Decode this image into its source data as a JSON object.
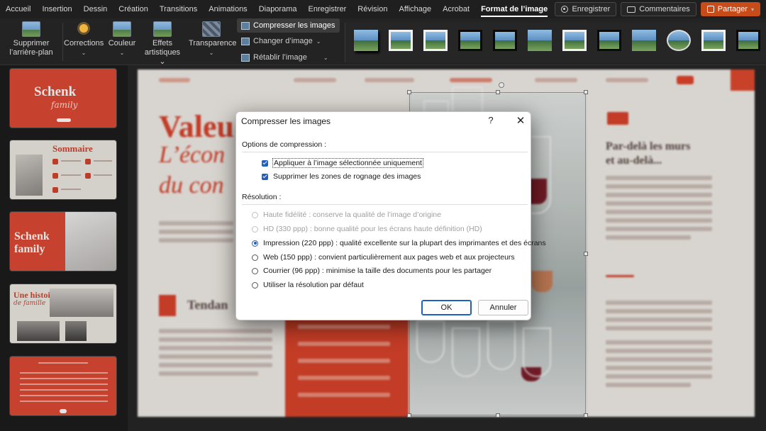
{
  "menu": {
    "tabs": [
      "Accueil",
      "Insertion",
      "Dessin",
      "Création",
      "Transitions",
      "Animations",
      "Diaporama",
      "Enregistrer",
      "Révision",
      "Affichage",
      "Acrobat",
      "Format de l’image"
    ],
    "active_tab": "Format de l’image",
    "record_label": "Enregistrer",
    "comments_label": "Commentaires",
    "share_label": "Partager"
  },
  "ribbon": {
    "remove_bg_l1": "Supprimer",
    "remove_bg_l2": "l’arrière-plan",
    "corrections_label": "Corrections",
    "color_label": "Couleur",
    "effects_l1": "Effets",
    "effects_l2": "artistiques",
    "transparency_label": "Transparence",
    "compress_label": "Compresser les images",
    "change_label": "Changer d’image",
    "reset_label": "Rétablir l’image"
  },
  "thumbnails": {
    "s1_title": "Schenk",
    "s1_sub": "family",
    "s2_title": "Sommaire",
    "s3_title_1": "Schenk",
    "s3_title_2": "family",
    "s4_title": "Une histoire",
    "s4_sub": "de famille"
  },
  "slide": {
    "big_title": "Valeu",
    "italic_1": "L’écon",
    "italic_2": "du con",
    "side_heading_1": "Par-delà les murs",
    "side_heading_2": "et au-delà...",
    "tend_heading": "Tendan"
  },
  "dialog": {
    "title": "Compresser les images",
    "help_glyph": "?",
    "close_glyph": "✕",
    "compression_heading": "Options de compression :",
    "apply_selected": "Appliquer à l’image sélectionnée uniquement",
    "delete_cropped": "Supprimer les zones de rognage des images",
    "resolution_heading": "Résolution :",
    "res_hifi": "Haute fidélité : conserve la qualité de l’image d’origine",
    "res_hd": "HD (330 ppp) : bonne qualité pour les écrans haute définition (HD)",
    "res_print": "Impression (220 ppp) : qualité excellente sur la plupart des imprimantes et des écrans",
    "res_web": "Web (150 ppp) : convient particulièrement aux pages web et aux projecteurs",
    "res_email": "Courrier (96 ppp) : minimise la taille des documents pour les partager",
    "res_default": "Utiliser la résolution par défaut",
    "selected_resolution": "Impression (220 ppp)",
    "ok_label": "OK",
    "cancel_label": "Annuler"
  },
  "colors": {
    "accent_blue": "#1f5fbf",
    "brand_red": "#d8432b",
    "share_orange": "#c84b1a"
  }
}
